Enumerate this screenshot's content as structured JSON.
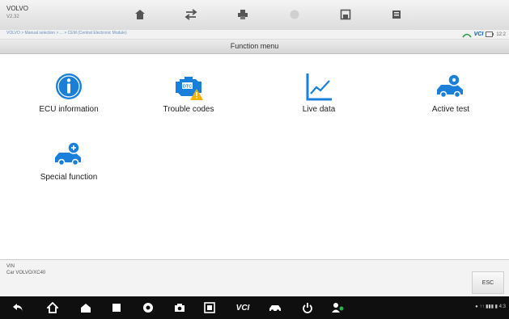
{
  "topbar": {
    "brand": "VOLVO",
    "version": "V2.32",
    "tools": [
      {
        "name": "home-icon"
      },
      {
        "name": "vehicle-swap-icon"
      },
      {
        "name": "print-icon"
      },
      {
        "name": "help-icon"
      },
      {
        "name": "save-icon"
      },
      {
        "name": "data-logging-icon"
      }
    ]
  },
  "breadcrumb": {
    "text": "VOLVO > Manual selection > ... > CEM (Central Electronic Module)"
  },
  "status": {
    "vci_label": "VCI",
    "time": "12:2"
  },
  "menu": {
    "title": "Function menu"
  },
  "functions": [
    {
      "label": "ECU information",
      "icon": "info-icon"
    },
    {
      "label": "Trouble codes",
      "icon": "engine-dtc-icon"
    },
    {
      "label": "Live data",
      "icon": "chart-line-icon"
    },
    {
      "label": "Active test",
      "icon": "car-test-icon"
    },
    {
      "label": "Special function",
      "icon": "car-special-icon"
    }
  ],
  "bottom": {
    "line1": "VIN",
    "line2": "Car VOLVO/XC40",
    "esc_label": "ESC"
  },
  "navbar": {
    "items": [
      "back-icon",
      "home-icon",
      "launcher-icon",
      "recent-apps-icon",
      "browser-icon",
      "camera-icon",
      "screenshot-icon",
      "vci-icon",
      "vehicle-icon",
      "power-icon",
      "user-switch-icon"
    ],
    "vci_text": "VCI",
    "system_status": "● ↑↑ ▮▮▮ ▮ 4:3"
  },
  "colors": {
    "accent": "#2b8ae6",
    "icon_blue": "#1a7fd9",
    "warning": "#f0b400"
  }
}
